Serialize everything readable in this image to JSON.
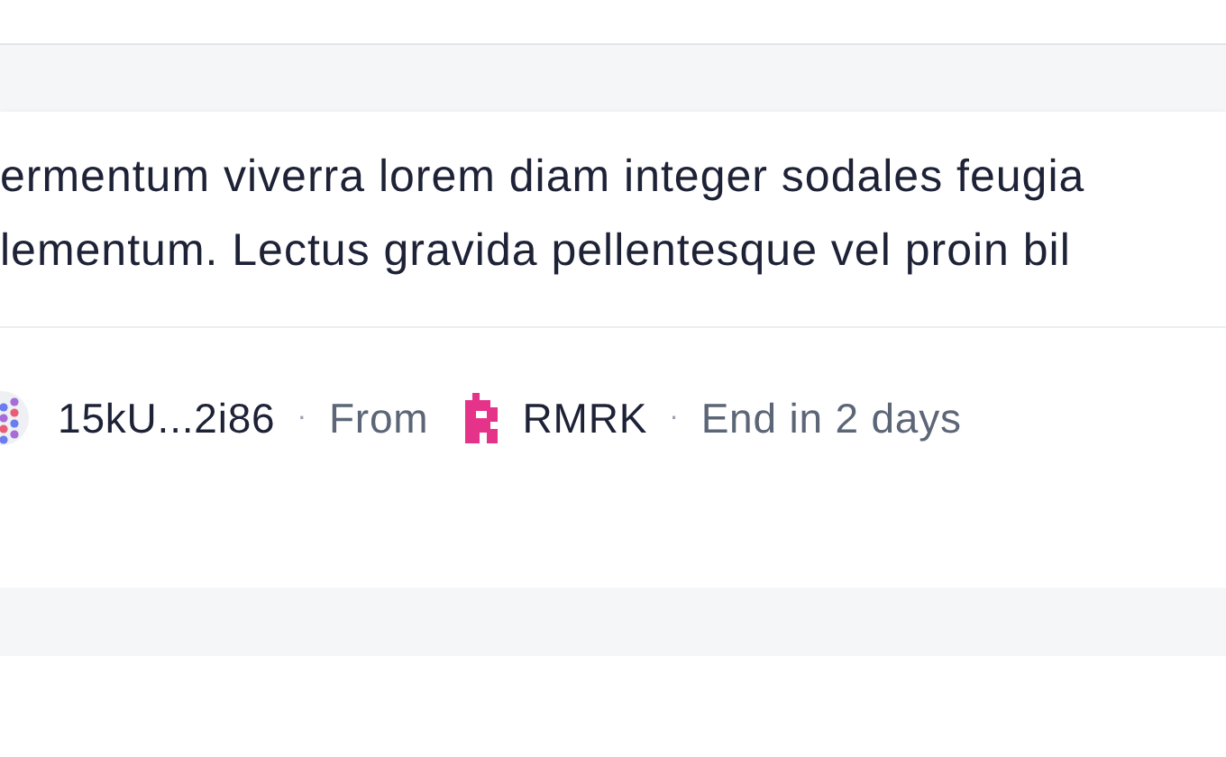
{
  "card": {
    "description_lines": [
      "ermentum viverra lorem diam integer sodales feugia",
      "lementum. Lectus gravida pellentesque vel proin bil"
    ],
    "footer": {
      "address": "15kU...2i86",
      "separator_1": "·",
      "from_label": "From",
      "source": "RMRK",
      "separator_2": "·",
      "ends": "End in 2 days"
    }
  }
}
